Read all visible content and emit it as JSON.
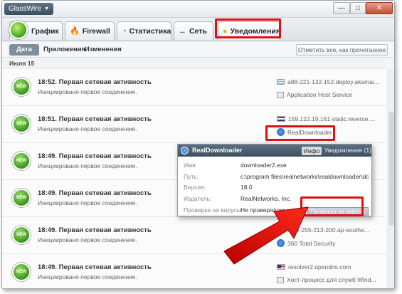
{
  "titlebar": {
    "app_name": "GlassWire",
    "caret": "▼",
    "min": "—",
    "max": "□",
    "close": "✕"
  },
  "tabs": [
    {
      "label": "График",
      "icon": "logo-icon"
    },
    {
      "label": "Firewall",
      "icon": "fire-icon"
    },
    {
      "label": "Статистика",
      "icon": "stats-icon"
    },
    {
      "label": "Сеть",
      "icon": "network-icon"
    },
    {
      "label": "Уведомления",
      "icon": "bulb-icon",
      "active": true
    }
  ],
  "subtabs": [
    {
      "label": "Дата",
      "active": true
    },
    {
      "label": "Приложения"
    },
    {
      "label": "Изменения"
    }
  ],
  "mark_all_label": "Отметить все, как прочитанное",
  "date_header": "Июля 15",
  "badge_label": "NEW",
  "rows": [
    {
      "title": "18:52. Первая сетевая активность",
      "sub": "Инициировано первое соединение.",
      "host": "a88-221-132-152.deploy.akamai...",
      "app": "Application Host Service"
    },
    {
      "title": "18:51. Первая сетевая активность",
      "sub": "Инициировано первое соединение.",
      "host": "159.122.19.161-static.reverse....",
      "app": "RealDownloader"
    },
    {
      "title": "18:49. Первая сетевая активность",
      "sub": "Инициировано первое соединение.",
      "host": "",
      "app": ""
    },
    {
      "title": "18:49. Первая сетевая активность",
      "sub": "Инициировано первое соединение.",
      "host": "",
      "app": ""
    },
    {
      "title": "18:49. Первая сетевая активность",
      "sub": "Инициировано первое соединение.",
      "host": "...54-255-213-200.ap-southe...",
      "app": "360 Total Security"
    },
    {
      "title": "18:49. Первая сетевая активность",
      "sub": "Инициировано первое соединение.",
      "host": "resolver2.opendns.com",
      "app": "Хост-процесс для служб Wind..."
    }
  ],
  "popup": {
    "title": "RealDownloader",
    "tab_info": "Инфо",
    "tab_notifications": "Уведомления (1)",
    "fields": [
      {
        "label": "Имя:",
        "value": "downloader2.exe"
      },
      {
        "label": "Путь:",
        "value": "c:\\program files\\realnetworks\\realdownloader\\do..."
      },
      {
        "label": "Версия:",
        "value": "18.0"
      },
      {
        "label": "Издатель:",
        "value": "RealNetworks, Inc."
      },
      {
        "label": "Проверка на вирусы:",
        "value": "Не проверялось"
      }
    ],
    "vt_button": "Проверка на вирусы"
  },
  "colors": {
    "annotation_red": "#e01010",
    "accent_green": "#3e9a1c",
    "header_dark": "#3e505f"
  }
}
